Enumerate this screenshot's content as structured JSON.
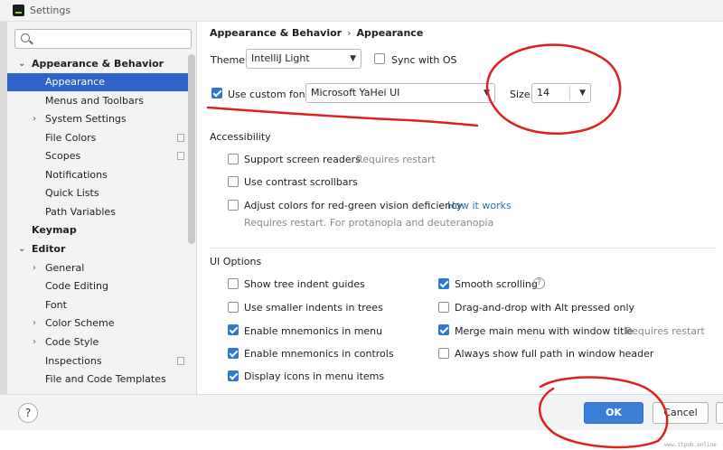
{
  "window": {
    "title": "Settings"
  },
  "search": {
    "placeholder": "",
    "value": ""
  },
  "sidebar": {
    "items": [
      {
        "label": "Appearance & Behavior",
        "level": 0,
        "expanded": true,
        "bold": true
      },
      {
        "label": "Appearance",
        "level": 1,
        "selected": true
      },
      {
        "label": "Menus and Toolbars",
        "level": 1
      },
      {
        "label": "System Settings",
        "level": 1,
        "collapsed": true
      },
      {
        "label": "File Colors",
        "level": 1,
        "project_icon": true
      },
      {
        "label": "Scopes",
        "level": 1,
        "project_icon": true
      },
      {
        "label": "Notifications",
        "level": 1
      },
      {
        "label": "Quick Lists",
        "level": 1
      },
      {
        "label": "Path Variables",
        "level": 1
      },
      {
        "label": "Keymap",
        "level": 0,
        "bold": true
      },
      {
        "label": "Editor",
        "level": 0,
        "expanded": true,
        "bold": true
      },
      {
        "label": "General",
        "level": 1,
        "collapsed": true
      },
      {
        "label": "Code Editing",
        "level": 1
      },
      {
        "label": "Font",
        "level": 1
      },
      {
        "label": "Color Scheme",
        "level": 1,
        "collapsed": true
      },
      {
        "label": "Code Style",
        "level": 1,
        "collapsed": true
      },
      {
        "label": "Inspections",
        "level": 1,
        "project_icon": true
      },
      {
        "label": "File and Code Templates",
        "level": 1
      }
    ]
  },
  "breadcrumb": {
    "parent": "Appearance & Behavior",
    "separator": "›",
    "current": "Appearance"
  },
  "theme": {
    "label": "Theme:",
    "value": "IntelliJ Light"
  },
  "sync_os": {
    "label": "Sync with OS",
    "checked": false
  },
  "custom_font": {
    "label": "Use custom font:",
    "checked": true,
    "value": "Microsoft YaHei UI"
  },
  "size": {
    "label": "Size:",
    "value": "14"
  },
  "accessibility": {
    "heading": "Accessibility",
    "screen_readers": {
      "label": "Support screen readers",
      "checked": false,
      "hint": "Requires restart"
    },
    "contrast_scrollbars": {
      "label": "Use contrast scrollbars",
      "checked": false
    },
    "color_deficiency": {
      "label": "Adjust colors for red-green vision deficiency",
      "checked": false,
      "link": "How it works",
      "hint": "Requires restart. For protanopia and deuteranopia"
    }
  },
  "ui_options": {
    "heading": "UI Options",
    "left": [
      {
        "label": "Show tree indent guides",
        "checked": false
      },
      {
        "label": "Use smaller indents in trees",
        "checked": false
      },
      {
        "label": "Enable mnemonics in menu",
        "checked": true
      },
      {
        "label": "Enable mnemonics in controls",
        "checked": true
      },
      {
        "label": "Display icons in menu items",
        "checked": true
      }
    ],
    "right": [
      {
        "label": "Smooth scrolling",
        "checked": true,
        "help": "?"
      },
      {
        "label": "Drag-and-drop with Alt pressed only",
        "checked": false
      },
      {
        "label": "Merge main menu with window title",
        "checked": true,
        "hint": "Requires restart"
      },
      {
        "label": "Always show full path in window header",
        "checked": false
      }
    ]
  },
  "footer": {
    "help": "?",
    "ok": "OK",
    "cancel": "Cancel"
  },
  "watermark": "www.itpub.online",
  "colors": {
    "accent": "#2f65ca",
    "ok_button": "#3b7ed6",
    "link": "#2b6fc0",
    "annotation": "#e0201e"
  }
}
